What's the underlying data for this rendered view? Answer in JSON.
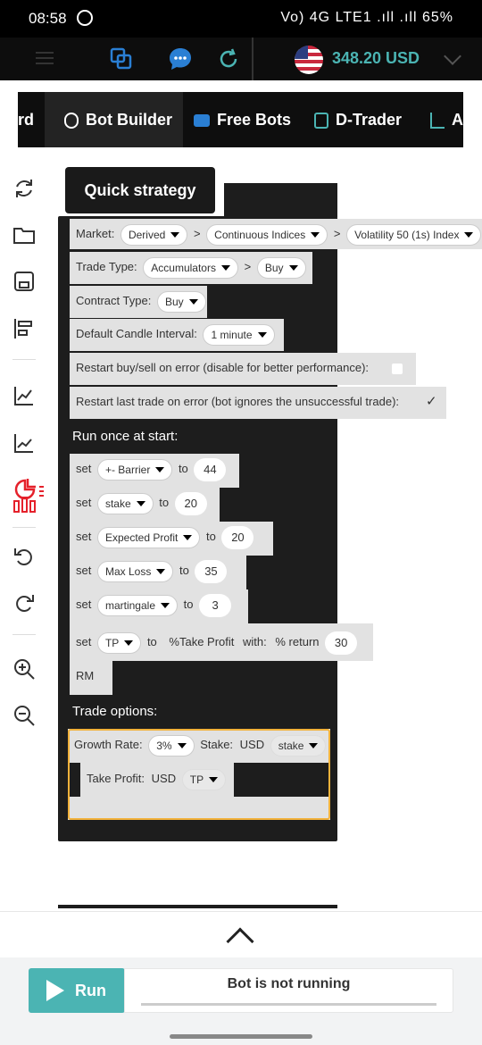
{
  "status_bar": {
    "time": "08:58",
    "indicators": "Vo) 4G LTE1 .ıll .ıll",
    "battery": "65%"
  },
  "header": {
    "balance": "348.20 USD"
  },
  "tabs": [
    {
      "label": "rd"
    },
    {
      "label": "Bot Builder"
    },
    {
      "label": "Free Bots"
    },
    {
      "label": "D-Trader"
    },
    {
      "label": "A"
    }
  ],
  "quick_strategy": "Quick strategy",
  "market": {
    "label": "Market:",
    "market": "Derived",
    "submarket": "Continuous Indices",
    "symbol": "Volatility 50 (1s) Index"
  },
  "trade_type": {
    "label": "Trade Type:",
    "category": "Accumulators",
    "type": "Buy"
  },
  "contract_type": {
    "label": "Contract Type:",
    "value": "Buy"
  },
  "candle": {
    "label": "Default Candle Interval:",
    "value": "1 minute"
  },
  "restart_buy": {
    "label": "Restart buy/sell on error (disable for better performance):",
    "checked": false
  },
  "restart_last": {
    "label": "Restart last trade on error (bot ignores the unsuccessful trade):",
    "checked": true,
    "mark": "✓"
  },
  "run_once": "Run once at start:",
  "vars": [
    {
      "set": "set",
      "name": "+- Barrier",
      "to": "to",
      "value": "44"
    },
    {
      "set": "set",
      "name": "stake",
      "to": "to",
      "value": "20"
    },
    {
      "set": "set",
      "name": "Expected Profit",
      "to": "to",
      "value": "20"
    },
    {
      "set": "set",
      "name": "Max Loss",
      "to": "to",
      "value": "35"
    },
    {
      "set": "set",
      "name": "martingale",
      "to": "to",
      "value": "3"
    }
  ],
  "tp_set": {
    "set": "set",
    "name": "TP",
    "to": "to",
    "func": "%Take Profit",
    "with": "with:",
    "param": "% return",
    "value": "30"
  },
  "rm": "RM",
  "trade_options": "Trade options:",
  "growth": {
    "label": "Growth Rate:",
    "rate": "3%",
    "stake_label": "Stake:",
    "currency": "USD",
    "stake_var": "stake"
  },
  "take_profit": {
    "label": "Take Profit:",
    "currency": "USD",
    "var": "TP"
  },
  "run": {
    "label": "Run",
    "status": "Bot is not running"
  },
  "colors": {
    "accent": "#4bb4b3",
    "block": "#1d1d1d",
    "highlight": "#f2b23b",
    "danger": "#e5212b"
  }
}
